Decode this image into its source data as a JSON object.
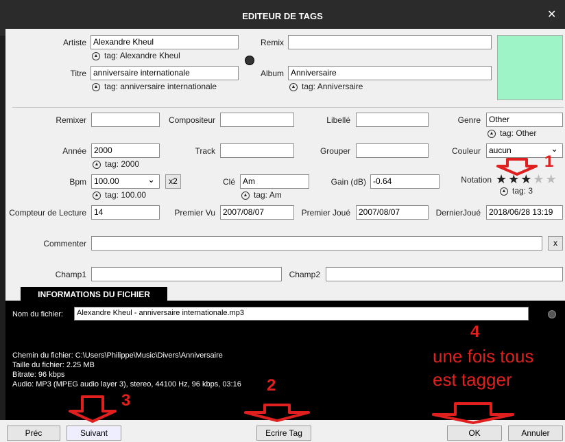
{
  "window": {
    "title": "EDITEUR DE TAGS",
    "close_glyph": "✕"
  },
  "artist": {
    "label": "Artiste",
    "value": "Alexandre Kheul",
    "tag": "tag: Alexandre Kheul"
  },
  "remix": {
    "label": "Remix",
    "value": ""
  },
  "title_field": {
    "label": "Titre",
    "value": "anniversaire internationale",
    "tag": "tag: anniversaire internationale"
  },
  "album": {
    "label": "Album",
    "value": "Anniversaire",
    "tag": "tag: Anniversaire"
  },
  "artwork": {
    "color": "#9ef4c6"
  },
  "remixer": {
    "label": "Remixer",
    "value": ""
  },
  "composer": {
    "label": "Compositeur",
    "value": ""
  },
  "label_field": {
    "label": "Libellé",
    "value": ""
  },
  "genre": {
    "label": "Genre",
    "value": "Other",
    "tag": "tag: Other"
  },
  "year": {
    "label": "Année",
    "value": "2000",
    "tag": "tag: 2000"
  },
  "track": {
    "label": "Track",
    "value": ""
  },
  "grouping": {
    "label": "Grouper",
    "value": ""
  },
  "color": {
    "label": "Couleur",
    "value": "aucun"
  },
  "bpm": {
    "label": "Bpm",
    "value": "100.00",
    "tag": "tag: 100.00",
    "x2": "x2"
  },
  "key": {
    "label": "Clé",
    "value": "Am",
    "tag": "tag: Am"
  },
  "gain": {
    "label": "Gain (dB)",
    "value": "-0.64"
  },
  "rating": {
    "label": "Notation",
    "value": 3,
    "max": 5,
    "tag": "tag: 3"
  },
  "play_count": {
    "label": "Compteur de Lecture",
    "value": "14"
  },
  "first_seen": {
    "label": "Premier Vu",
    "value": "2007/08/07"
  },
  "first_played": {
    "label": "Premier Joué",
    "value": "2007/08/07"
  },
  "last_played": {
    "label": "DernierJoué",
    "value": "2018/06/28 13:19"
  },
  "comment": {
    "label": "Commenter",
    "value": "",
    "clear": "x"
  },
  "field1": {
    "label": "Champ1",
    "value": ""
  },
  "field2": {
    "label": "Champ2",
    "value": ""
  },
  "file_info": {
    "tab": "INFORMATIONS DU FICHIER",
    "filename_label": "Nom du fichier:",
    "filename": "Alexandre Kheul - anniversaire internationale.mp3",
    "path": "Chemin du fichier: C:\\Users\\Philippe\\Music\\Divers\\Anniversaire",
    "size": "Taille du fichier: 2.25 MB",
    "bitrate": "Bitrate: 96 kbps",
    "audio": "Audio: MP3 (MPEG audio layer 3), stereo, 44100 Hz, 96 kbps, 03:16"
  },
  "buttons": {
    "prev": "Préc",
    "next": "Suivant",
    "write": "Ecrire Tag",
    "ok": "OK",
    "cancel": "Annuler"
  },
  "annotations": {
    "n1": "1",
    "n2": "2",
    "n3": "3",
    "n4": "4",
    "line1": "une fois tous",
    "line2": "est tagger",
    "arrow_color": "#e0201e"
  }
}
